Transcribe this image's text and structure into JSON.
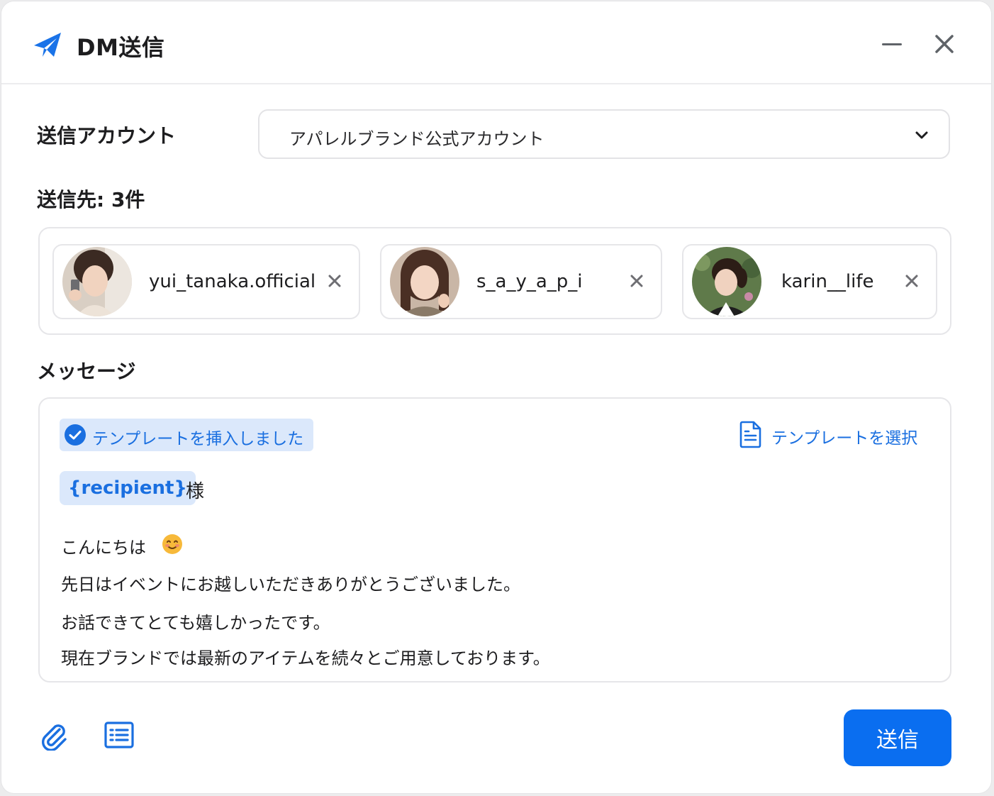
{
  "window": {
    "title": "DM送信",
    "title_icon": "paper-plane-icon",
    "minimize_icon": "minimize-icon",
    "close_icon": "close-icon"
  },
  "account": {
    "label": "送信アカウント",
    "selected": "アパレルブランド公式アカウント"
  },
  "recipients": {
    "label": "送信先: 3件",
    "items": [
      {
        "name": "yui_tanaka.official"
      },
      {
        "name": "s_a_y_a_p_i"
      },
      {
        "name": "karin__life"
      }
    ]
  },
  "message": {
    "label": "メッセージ",
    "notice": "テンプレートを挿入しました",
    "template_select": "テンプレートを選択",
    "variable": "{recipient}",
    "variable_suffix": "様",
    "lines": [
      "こんにちは",
      "先日はイベントにお越しいただきありがとうございました。",
      "お話できてとても嬉しかったです。",
      "現在ブランドでは最新のアイテムを続々とご用意しております。"
    ]
  },
  "footer": {
    "attach_icon": "paperclip-icon",
    "list_icon": "list-icon",
    "send_label": "送信"
  },
  "colors": {
    "accent": "#0a6ef0",
    "accent_light": "#dbe8fb",
    "border": "#e6e6e9"
  }
}
